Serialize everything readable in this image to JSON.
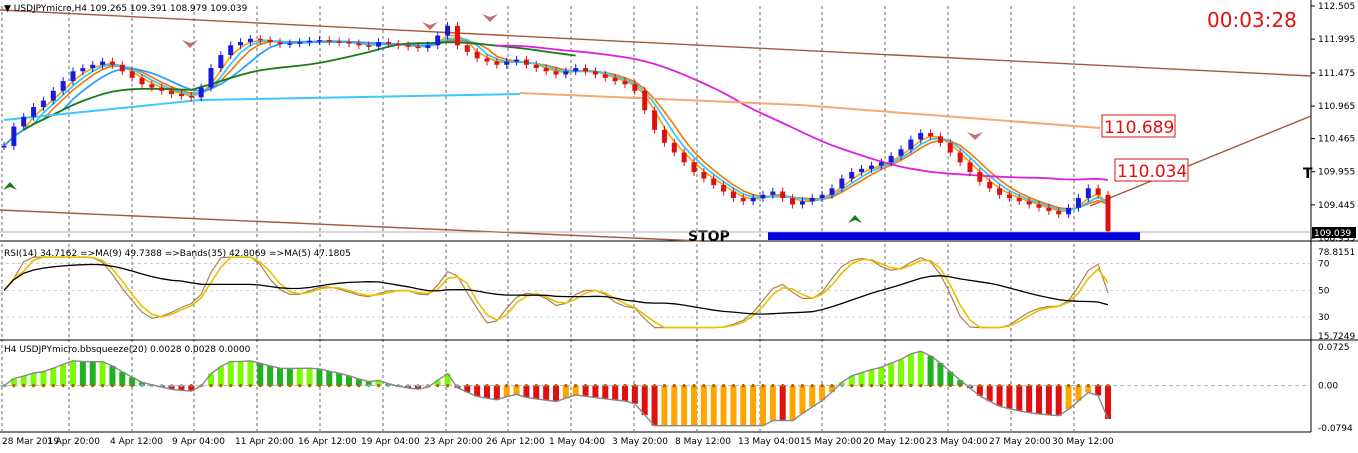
{
  "header": {
    "symbol_line": "USDJPYmicro,H4  109.265 109.391 108.979 109.039",
    "timer": "00:03:28",
    "rsi_line": "RSI(14) 34.7162  =>MA(9) 49.7388  =>Bands(35) 42.8069  =>MA(5) 47.1805",
    "bbs_line": "H4 USDJPYmicro.bbsqueeze(20) 0.0028 0.0028 0.0000"
  },
  "annotations": {
    "stop_label": "STOP",
    "level_upper": "110.689",
    "level_lower": "110.034",
    "right_marker": "T",
    "current_price": "109.039"
  },
  "colors": {
    "bull": "#1a1adf",
    "bear": "#e01010",
    "ma_fast": "#f5a000",
    "ma_mid": "#f07800",
    "ma_cyan": "#3cc8ff",
    "ma_slow_blue": "#2ea0ff",
    "ma_green": "#1a7a1a",
    "ma_magenta": "#e020e0",
    "ma_peach": "#f5a870",
    "channel": "#a05a3a",
    "stop_bar": "#0000e0",
    "hist_green": "#20b020",
    "hist_lime": "#7cfc00",
    "hist_red": "#e01010",
    "hist_orange": "#ffa500",
    "label_red": "#e01010"
  },
  "chart_data": [
    {
      "type": "candlestick",
      "name": "price",
      "price_axis_ticks": [
        "112.505",
        "111.995",
        "111.475",
        "110.965",
        "110.465",
        "109.955",
        "109.445",
        "108.935"
      ],
      "ylim": [
        108.935,
        112.505
      ],
      "x_labels": [
        "28 Mar 2019",
        "1 Apr 20:00",
        "4 Apr 12:00",
        "9 Apr 04:00",
        "11 Apr 20:00",
        "16 Apr 12:00",
        "19 Apr 04:00",
        "23 Apr 20:00",
        "26 Apr 12:00",
        "1 May 04:00",
        "3 May 20:00",
        "8 May 12:00",
        "13 May 04:00",
        "15 May 20:00",
        "20 May 12:00",
        "23 May 04:00",
        "27 May 20:00",
        "30 May 12:00"
      ],
      "close_series": [
        110.35,
        110.65,
        110.8,
        110.95,
        111.05,
        111.2,
        111.35,
        111.5,
        111.55,
        111.6,
        111.65,
        111.6,
        111.5,
        111.4,
        111.3,
        111.25,
        111.2,
        111.15,
        111.12,
        111.1,
        111.25,
        111.55,
        111.75,
        111.9,
        111.95,
        112.0,
        111.98,
        111.95,
        111.92,
        111.93,
        111.95,
        111.97,
        111.98,
        111.96,
        111.95,
        111.93,
        111.9,
        111.88,
        111.95,
        111.92,
        111.9,
        111.88,
        111.86,
        111.9,
        112.05,
        112.2,
        111.9,
        111.8,
        111.7,
        111.65,
        111.6,
        111.65,
        111.68,
        111.6,
        111.55,
        111.5,
        111.45,
        111.5,
        111.55,
        111.5,
        111.45,
        111.4,
        111.35,
        111.3,
        111.2,
        110.9,
        110.6,
        110.4,
        110.25,
        110.1,
        109.95,
        109.85,
        109.75,
        109.65,
        109.55,
        109.5,
        109.55,
        109.6,
        109.65,
        109.55,
        109.45,
        109.5,
        109.55,
        109.6,
        109.7,
        109.85,
        109.95,
        110.0,
        110.05,
        110.1,
        110.2,
        110.3,
        110.45,
        110.55,
        110.5,
        110.4,
        110.25,
        110.1,
        109.95,
        109.8,
        109.7,
        109.6,
        109.55,
        109.5,
        109.45,
        109.4,
        109.35,
        109.3,
        109.4,
        109.55,
        109.7,
        109.6,
        109.04
      ],
      "levels": [
        110.689,
        110.034
      ],
      "current_price": 109.039
    },
    {
      "type": "line",
      "name": "rsi",
      "axis_ticks": [
        "78.8151",
        "70",
        "50",
        "30",
        "15.7249"
      ],
      "ylim": [
        15.7249,
        78.8151
      ]
    },
    {
      "type": "bar",
      "name": "bbsqueeze",
      "axis_ticks": [
        "0.0725",
        "0.00",
        "-0.0794"
      ],
      "ylim": [
        -0.0794,
        0.0725
      ]
    }
  ]
}
